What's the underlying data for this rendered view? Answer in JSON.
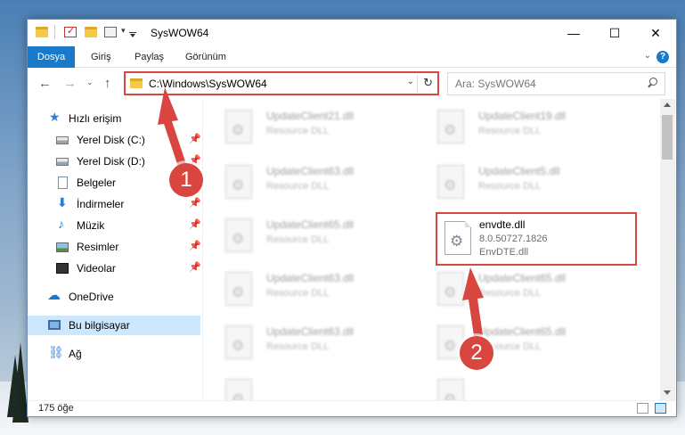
{
  "window": {
    "title": "SysWOW64",
    "controls": {
      "minimize": "—",
      "maximize": "☐",
      "close": "✕"
    }
  },
  "ribbon": {
    "tabs": [
      "Dosya",
      "Giriş",
      "Paylaş",
      "Görünüm"
    ],
    "help": "?"
  },
  "address": {
    "path": "C:\\Windows\\SysWOW64",
    "search_placeholder": "Ara: SysWOW64"
  },
  "sidebar": {
    "items": [
      {
        "label": "Hızlı erişim",
        "icon": "star-icon",
        "pinned": false
      },
      {
        "label": "Yerel Disk (C:)",
        "icon": "drive-icon",
        "pinned": true
      },
      {
        "label": "Yerel Disk (D:)",
        "icon": "drive-icon",
        "pinned": true
      },
      {
        "label": "Belgeler",
        "icon": "document-icon",
        "pinned": true
      },
      {
        "label": "İndirmeler",
        "icon": "download-icon",
        "pinned": true
      },
      {
        "label": "Müzik",
        "icon": "music-icon",
        "pinned": true
      },
      {
        "label": "Resimler",
        "icon": "pictures-icon",
        "pinned": true
      },
      {
        "label": "Videolar",
        "icon": "video-icon",
        "pinned": true
      },
      {
        "label": "OneDrive",
        "icon": "cloud-icon",
        "pinned": false
      },
      {
        "label": "Bu bilgisayar",
        "icon": "computer-icon",
        "pinned": false,
        "selected": true
      },
      {
        "label": "Ağ",
        "icon": "network-icon",
        "pinned": false
      }
    ]
  },
  "files": {
    "blurred": [
      {
        "name": "UpdateClient21.dll",
        "desc": "Resource DLL"
      },
      {
        "name": "UpdateClient19.dll",
        "desc": "Resource DLL"
      },
      {
        "name": "UpdateClient63.dll",
        "desc": "Resource DLL"
      },
      {
        "name": "UpdateClient5.dll",
        "desc": "Resource DLL"
      },
      {
        "name": "UpdateClient65.dll",
        "desc": "Resource DLL"
      },
      {
        "name": "UpdateClient63.dll",
        "desc": "Resource DLL"
      },
      {
        "name": "UpdateClient65.dll",
        "desc": "Resource DLL"
      },
      {
        "name": "UpdateClient63.dll",
        "desc": "Resource DLL"
      },
      {
        "name": "UpdateClient65.dll",
        "desc": "Resource DLL"
      }
    ],
    "highlighted": {
      "name": "envdte.dll",
      "version": "8.0.50727.1826",
      "description": "EnvDTE.dll"
    }
  },
  "status": {
    "count": "175 öğe"
  },
  "callouts": {
    "one": "1",
    "two": "2"
  },
  "colors": {
    "accent": "#1979ca",
    "callout": "#d9463f"
  }
}
